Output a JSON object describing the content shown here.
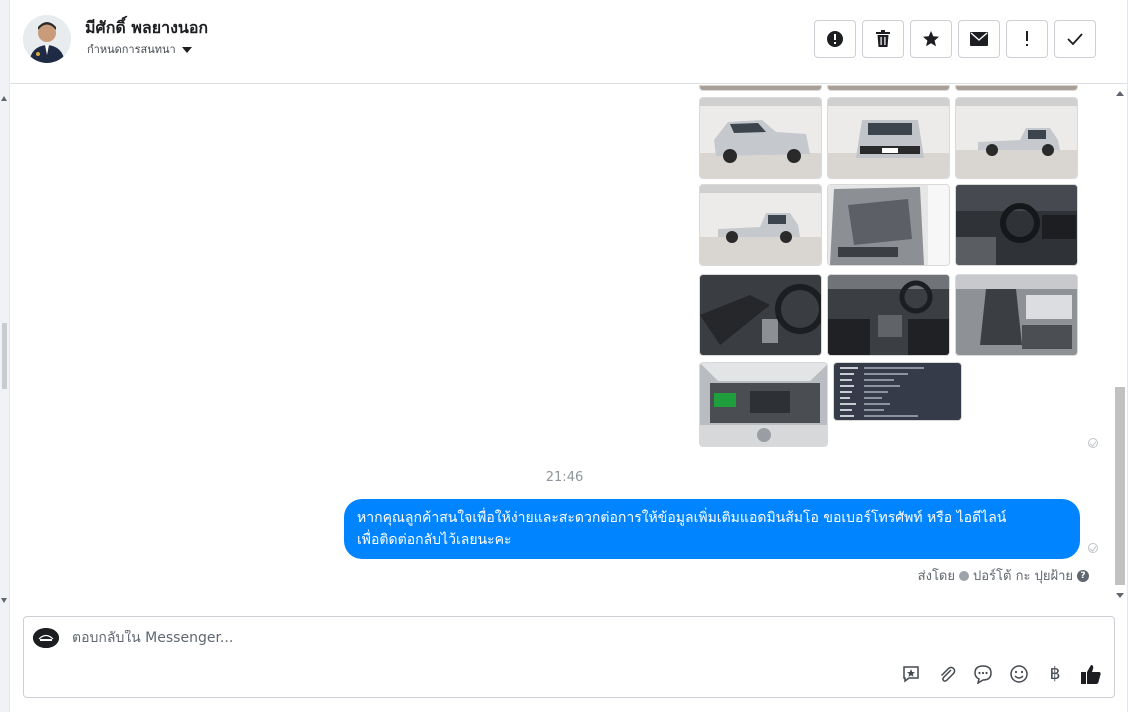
{
  "header": {
    "name": "มีศักดิ์ พลยางนอก",
    "assign_label": "กำหนดการสนทนา",
    "actions": [
      "mark-spam",
      "delete",
      "star",
      "mark-unread",
      "follow-up",
      "done"
    ]
  },
  "conversation": {
    "timestamp": "21:46",
    "message_text_line1": "หากคุณลูกค้าสนใจเพื่อให้ง่ายและสะดวกต่อการให้ข้อมูลเพิ่มเติมแอดมินส้มโอ ขอเบอร์โทรศัพท์ หรือ ไอดีไลน์",
    "message_text_line2": "เพื่อติดต่อกลับไว้เลยนะคะ",
    "sent_by_label": "ส่งโดย",
    "sent_by_name": "ปอร์โต้ กะ ปุยฝ้าย",
    "help_glyph": "?"
  },
  "composer": {
    "placeholder": "ตอบกลับใน Messenger...",
    "currency_glyph": "฿"
  },
  "colors": {
    "bubble": "#0084ff",
    "border": "#ccd0d5",
    "muted": "#90949c"
  }
}
